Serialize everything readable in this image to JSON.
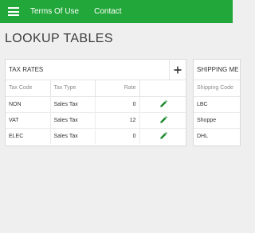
{
  "topbar": {
    "menu_icon": "hamburger-menu-icon",
    "links": [
      "Terms Of Use",
      "Contact"
    ],
    "color": "#22a83a"
  },
  "page": {
    "title": "LOOKUP TABLES"
  },
  "tax_rates": {
    "title": "TAX RATES",
    "add_icon": "plus-icon",
    "columns": [
      "Tax Code",
      "Tax Type",
      "Rate",
      ""
    ],
    "rows": [
      {
        "code": "NON",
        "type": "Sales Tax",
        "rate": "0"
      },
      {
        "code": "VAT",
        "type": "Sales Tax",
        "rate": "12"
      },
      {
        "code": "ELEC",
        "type": "Sales Tax",
        "rate": "0"
      }
    ],
    "edit_icon": "pencil-edit-icon",
    "edit_icon_color": "#1f8a2e"
  },
  "shipping": {
    "title": "SHIPPING ME",
    "columns": [
      "Shipping Code"
    ],
    "rows": [
      {
        "code": "LBC"
      },
      {
        "code": "Shoppe"
      },
      {
        "code": "DHL"
      }
    ]
  }
}
